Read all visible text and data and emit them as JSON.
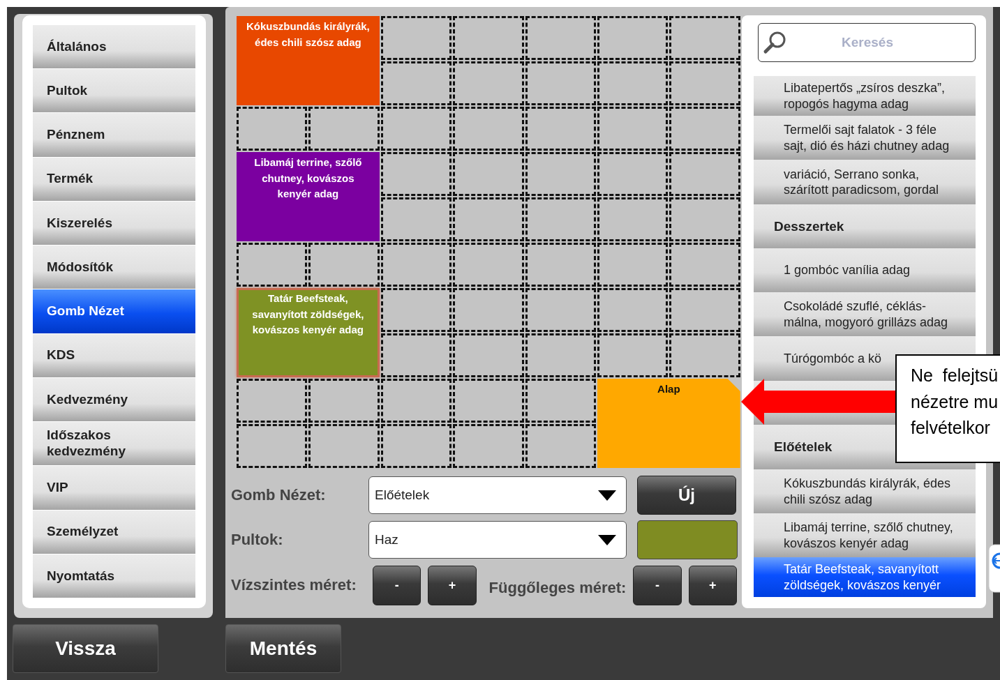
{
  "menu": [
    {
      "label": "Általános",
      "selected": false
    },
    {
      "label": "Pultok",
      "selected": false
    },
    {
      "label": "Pénznem",
      "selected": false
    },
    {
      "label": "Termék",
      "selected": false
    },
    {
      "label": "Kiszerelés",
      "selected": false
    },
    {
      "label": "Módosítók",
      "selected": false
    },
    {
      "label": "Gomb Nézet",
      "selected": true
    },
    {
      "label": "KDS",
      "selected": false
    },
    {
      "label": "Kedvezmény",
      "selected": false
    },
    {
      "label": "Időszakos\nkedvezmény",
      "selected": false
    },
    {
      "label": "VIP",
      "selected": false
    },
    {
      "label": "Személyzet",
      "selected": false
    },
    {
      "label": "Nyomtatás",
      "selected": false
    }
  ],
  "grid_buttons": [
    {
      "label": "Kókuszbundás királyrák,\nédes chili szósz adag",
      "color": "#e84800",
      "selected": false,
      "kind": "product"
    },
    {
      "label": "Libamáj terrine, szőlő\nchutney, kovászos\nkenyér adag",
      "color": "#7b00a0",
      "selected": false,
      "kind": "product"
    },
    {
      "label": "Tatár Beefsteak,\nsavanyított zöldségek,\nkovászos kenyér adag",
      "color": "#7f9224",
      "selected": true,
      "kind": "product"
    },
    {
      "label": "Alap",
      "color": "#ffa800",
      "selected": false,
      "kind": "view"
    }
  ],
  "form": {
    "view_label": "Gomb Nézet:",
    "view_value": "Előételek",
    "new_button": "Új",
    "counter_label": "Pultok:",
    "counter_value": "Haz",
    "swatch": {
      "color": "#7f8c22"
    },
    "horizontal_label": "Vízszintes méret:",
    "vertical_label": "Függőleges méret:",
    "minus": "-",
    "plus": "+"
  },
  "search": {
    "placeholder": "Keresés"
  },
  "list": [
    {
      "kind": "item",
      "label": "Libatepertős „zsíros deszka”,\nropogós hagyma adag",
      "selected": false
    },
    {
      "kind": "item",
      "label": "Termelői sajt falatok - 3 féle\nsajt, dió és házi chutney adag",
      "selected": false
    },
    {
      "kind": "item",
      "label": "variáció, Serrano sonka,\nszárított paradicsom, gordal",
      "selected": false
    },
    {
      "kind": "header",
      "label": "Desszertek",
      "selected": false
    },
    {
      "kind": "item",
      "label": "1 gombóc vanília adag",
      "selected": false
    },
    {
      "kind": "item",
      "label": "Csokoládé szuflé, céklás-\nmálna, mogyoró grillázs adag",
      "selected": false
    },
    {
      "kind": "item",
      "label": "Túrógombóc a kö",
      "selected": false
    },
    {
      "kind": "hidden"
    },
    {
      "kind": "header",
      "label": "Előételek",
      "selected": false
    },
    {
      "kind": "item",
      "label": "Kókuszbundás királyrák, édes\nchili szósz adag",
      "selected": false
    },
    {
      "kind": "item",
      "label": "Libamáj terrine, szőlő chutney,\nkovászos kenyér adag",
      "selected": false
    },
    {
      "kind": "item",
      "label": "Tatár Beefsteak, savanyított\nzöldségek, kovászos kenyér",
      "selected": true
    }
  ],
  "footer": {
    "back": "Vissza",
    "save": "Mentés"
  },
  "callout": {
    "text": "Ne  felejtsü\nnézetre mu\nfelvételkor"
  }
}
